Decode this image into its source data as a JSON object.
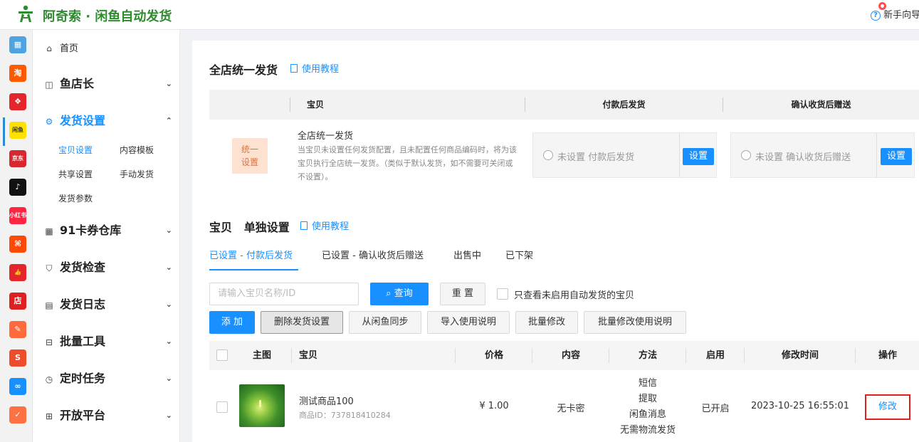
{
  "header": {
    "brand": "阿奇索 · 闲鱼自动发货",
    "help_label": "新手向导"
  },
  "rail": [
    {
      "name": "grid-app-icon",
      "color": "#4fa3e0",
      "glyph": "▦"
    },
    {
      "name": "taobao-icon",
      "color": "#ff5a00",
      "glyph": "淘"
    },
    {
      "name": "tmall-icon",
      "color": "#e4252c",
      "glyph": "❖"
    },
    {
      "name": "xianyu-icon",
      "color": "#ffe100",
      "glyph": "闲鱼"
    },
    {
      "name": "jd-icon",
      "color": "#d7282f",
      "glyph": "京东"
    },
    {
      "name": "douyin-icon",
      "color": "#111111",
      "glyph": "♪"
    },
    {
      "name": "xiaohongshu-icon",
      "color": "#ff2442",
      "glyph": "小红书"
    },
    {
      "name": "kuaishou-icon",
      "color": "#ff4906",
      "glyph": "⌘"
    },
    {
      "name": "thumb-up-icon",
      "color": "#e4252c",
      "glyph": "👍"
    },
    {
      "name": "shop-icon",
      "color": "#e02020",
      "glyph": "店"
    },
    {
      "name": "bag-icon",
      "color": "#ff6a3d",
      "glyph": "✎"
    },
    {
      "name": "shopee-icon",
      "color": "#ee4d2d",
      "glyph": "S"
    },
    {
      "name": "link-icon",
      "color": "#1890ff",
      "glyph": "∞"
    },
    {
      "name": "task-icon",
      "color": "#ff7043",
      "glyph": "✓"
    }
  ],
  "sidebar": {
    "home": "首页",
    "fish_manager": "鱼店长",
    "delivery_settings": "发货设置",
    "sub_items": {
      "item_settings": "宝贝设置",
      "content_template": "内容模板",
      "shared_settings": "共享设置",
      "manual_delivery": "手动发货",
      "delivery_params": "发货参数"
    },
    "card_warehouse": "91卡券仓库",
    "delivery_check": "发货检查",
    "delivery_log": "发货日志",
    "batch_tools": "批量工具",
    "scheduled_tasks": "定时任务",
    "open_platform": "开放平台"
  },
  "global_section": {
    "title": "全店统一发货",
    "tutorial": "使用教程",
    "columns": [
      "宝贝",
      "付款后发货",
      "确认收货后赠送"
    ],
    "tag_line1": "统一",
    "tag_line2": "设置",
    "desc_title": "全店统一发货",
    "desc": "当宝贝未设置任何发货配置，且未配置任何商品编码时，将为该宝贝执行全店统一发货。（类似于默认发货，如不需要可关闭或不设置）。",
    "after_payment": {
      "label": "未设置 付款后发货",
      "button": "设置"
    },
    "after_confirm": {
      "label": "未设置 确认收货后赠送",
      "button": "设置"
    }
  },
  "item_section": {
    "title_prefix": "宝贝",
    "title": "单独设置",
    "tutorial": "使用教程",
    "tabs": [
      "已设置 - 付款后发货",
      "已设置 - 确认收货后赠送",
      "出售中",
      "已下架"
    ],
    "search_placeholder": "请输入宝贝名称/ID",
    "search_button": "查询",
    "reset_button": "重 置",
    "only_disabled_label": "只查看未启用自动发货的宝贝",
    "actions": {
      "add": "添 加",
      "delete": "删除发货设置",
      "sync": "从闲鱼同步",
      "import_help": "导入使用说明",
      "batch_edit": "批量修改",
      "batch_edit_help": "批量修改使用说明"
    },
    "columns": {
      "image": "主图",
      "item": "宝贝",
      "price": "价格",
      "content": "内容",
      "method": "方法",
      "enabled": "启用",
      "modified": "修改时间",
      "action": "操作"
    },
    "rows": [
      {
        "name": "测试商品100",
        "id_text": "商品ID：737818410284",
        "price": "¥ 1.00",
        "content": "无卡密",
        "methods": [
          "短信",
          "提取",
          "闲鱼消息",
          "无需物流发货"
        ],
        "enabled": "已开启",
        "modified": "2023-10-25 16:55:01",
        "action": "修改"
      }
    ]
  }
}
